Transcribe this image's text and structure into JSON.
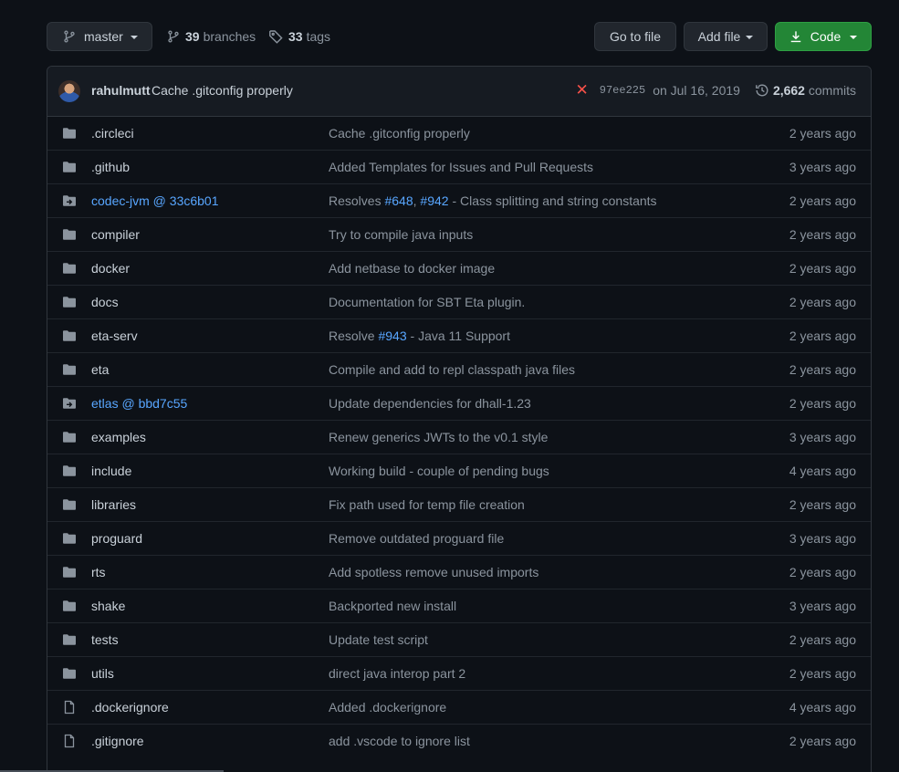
{
  "toolbar": {
    "branch": "master",
    "branches_count": "39",
    "branches_label": "branches",
    "tags_count": "33",
    "tags_label": "tags",
    "go_to_file": "Go to file",
    "add_file": "Add file",
    "code": "Code"
  },
  "commit": {
    "author": "rahulmutt",
    "message": "Cache .gitconfig properly",
    "sha": "97ee225",
    "date": "on Jul 16, 2019",
    "commits_count": "2,662",
    "commits_label": "commits"
  },
  "colors": {
    "background": "#0d1117",
    "link": "#58a6ff",
    "primary_button": "#238636",
    "failure": "#f85149"
  },
  "files": [
    {
      "icon": "folder-icon",
      "name": ".circleci",
      "message": [
        {
          "text": "Cache .gitconfig properly"
        }
      ],
      "age": "2 years ago"
    },
    {
      "icon": "folder-icon",
      "name": ".github",
      "message": [
        {
          "text": "Added Templates for Issues and Pull Requests"
        }
      ],
      "age": "3 years ago"
    },
    {
      "icon": "submodule-icon",
      "name": "codec-jvm @ 33c6b01",
      "link": true,
      "message": [
        {
          "text": "Resolves "
        },
        {
          "text": "#648",
          "ref": true
        },
        {
          "text": ", "
        },
        {
          "text": "#942",
          "ref": true
        },
        {
          "text": " - Class splitting and string constants"
        }
      ],
      "age": "2 years ago"
    },
    {
      "icon": "folder-icon",
      "name": "compiler",
      "message": [
        {
          "text": "Try to compile java inputs"
        }
      ],
      "age": "2 years ago"
    },
    {
      "icon": "folder-icon",
      "name": "docker",
      "message": [
        {
          "text": "Add netbase to docker image"
        }
      ],
      "age": "2 years ago"
    },
    {
      "icon": "folder-icon",
      "name": "docs",
      "message": [
        {
          "text": "Documentation for SBT Eta plugin."
        }
      ],
      "age": "2 years ago"
    },
    {
      "icon": "folder-icon",
      "name": "eta-serv",
      "message": [
        {
          "text": "Resolve "
        },
        {
          "text": "#943",
          "ref": true
        },
        {
          "text": " - Java 11 Support"
        }
      ],
      "age": "2 years ago"
    },
    {
      "icon": "folder-icon",
      "name": "eta",
      "message": [
        {
          "text": "Compile and add to repl classpath java files"
        }
      ],
      "age": "2 years ago"
    },
    {
      "icon": "submodule-icon",
      "name": "etlas @ bbd7c55",
      "link": true,
      "message": [
        {
          "text": "Update dependencies for dhall-1.23"
        }
      ],
      "age": "2 years ago"
    },
    {
      "icon": "folder-icon",
      "name": "examples",
      "message": [
        {
          "text": "Renew generics JWTs to the v0.1 style"
        }
      ],
      "age": "3 years ago"
    },
    {
      "icon": "folder-icon",
      "name": "include",
      "message": [
        {
          "text": "Working build - couple of pending bugs"
        }
      ],
      "age": "4 years ago"
    },
    {
      "icon": "folder-icon",
      "name": "libraries",
      "message": [
        {
          "text": "Fix path used for temp file creation"
        }
      ],
      "age": "2 years ago"
    },
    {
      "icon": "folder-icon",
      "name": "proguard",
      "message": [
        {
          "text": "Remove outdated proguard file"
        }
      ],
      "age": "3 years ago"
    },
    {
      "icon": "folder-icon",
      "name": "rts",
      "message": [
        {
          "text": "Add spotless remove unused imports"
        }
      ],
      "age": "2 years ago"
    },
    {
      "icon": "folder-icon",
      "name": "shake",
      "message": [
        {
          "text": "Backported new install"
        }
      ],
      "age": "3 years ago"
    },
    {
      "icon": "folder-icon",
      "name": "tests",
      "message": [
        {
          "text": "Update test script"
        }
      ],
      "age": "2 years ago"
    },
    {
      "icon": "folder-icon",
      "name": "utils",
      "message": [
        {
          "text": "direct java interop part 2"
        }
      ],
      "age": "2 years ago"
    },
    {
      "icon": "file-icon",
      "name": ".dockerignore",
      "message": [
        {
          "text": "Added .dockerignore"
        }
      ],
      "age": "4 years ago"
    },
    {
      "icon": "file-icon",
      "name": ".gitignore",
      "message": [
        {
          "text": "add .vscode to ignore list"
        }
      ],
      "age": "2 years ago"
    }
  ]
}
